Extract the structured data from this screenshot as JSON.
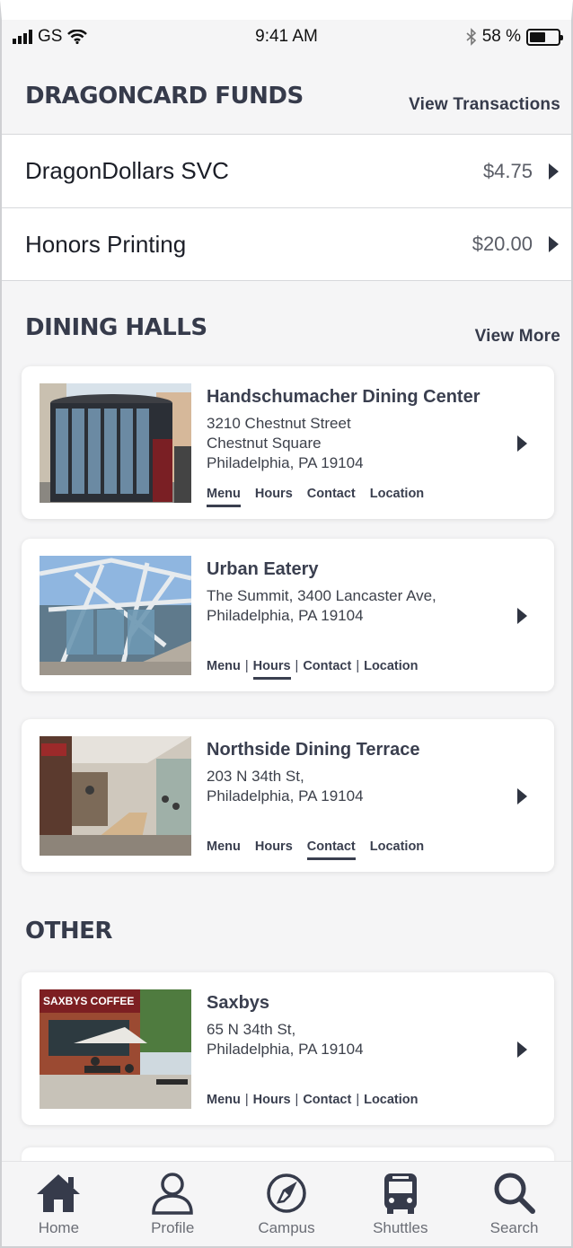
{
  "status_bar": {
    "carrier": "GS",
    "time": "9:41 AM",
    "battery": "58 %"
  },
  "funds": {
    "title": "DRAGONCARD FUNDS",
    "link": "View Transactions",
    "items": [
      {
        "name": "DragonDollars SVC",
        "amount": "$4.75"
      },
      {
        "name": "Honors Printing",
        "amount": "$20.00"
      }
    ]
  },
  "dining": {
    "title": "DINING HALLS",
    "link": "View More",
    "items": [
      {
        "name": "Handschumacher Dining Center",
        "address": [
          "3210 Chestnut Street",
          "Chestnut Square",
          "Philadelphia, PA 19104"
        ],
        "links": [
          "Menu",
          "Hours",
          "Contact",
          "Location"
        ],
        "active": "Menu"
      },
      {
        "name": "Urban Eatery",
        "address": [
          "The Summit, 3400 Lancaster Ave,",
          "Philadelphia, PA 19104"
        ],
        "links": [
          "Menu",
          "Hours",
          "Contact",
          "Location"
        ],
        "active": "Hours"
      },
      {
        "name": "Northside Dining Terrace",
        "address": [
          "203 N 34th St,",
          "Philadelphia, PA 19104"
        ],
        "links": [
          "Menu",
          "Hours",
          "Contact",
          "Location"
        ],
        "active": "Contact"
      }
    ]
  },
  "other": {
    "title": "OTHER",
    "items": [
      {
        "name": "Saxbys",
        "address": [
          "65 N 34th St,",
          "Philadelphia, PA 19104"
        ],
        "links": [
          "Menu",
          "Hours",
          "Contact",
          "Location"
        ],
        "sign_text": "SAXBYS COFFEE"
      }
    ]
  },
  "tabs": [
    {
      "label": "Home",
      "icon": "home-icon"
    },
    {
      "label": "Profile",
      "icon": "profile-icon"
    },
    {
      "label": "Campus",
      "icon": "compass-icon"
    },
    {
      "label": "Shuttles",
      "icon": "bus-icon"
    },
    {
      "label": "Search",
      "icon": "search-icon"
    }
  ],
  "colors": {
    "heading": "#363b4b",
    "background": "#f5f5f6",
    "card": "#ffffff"
  }
}
